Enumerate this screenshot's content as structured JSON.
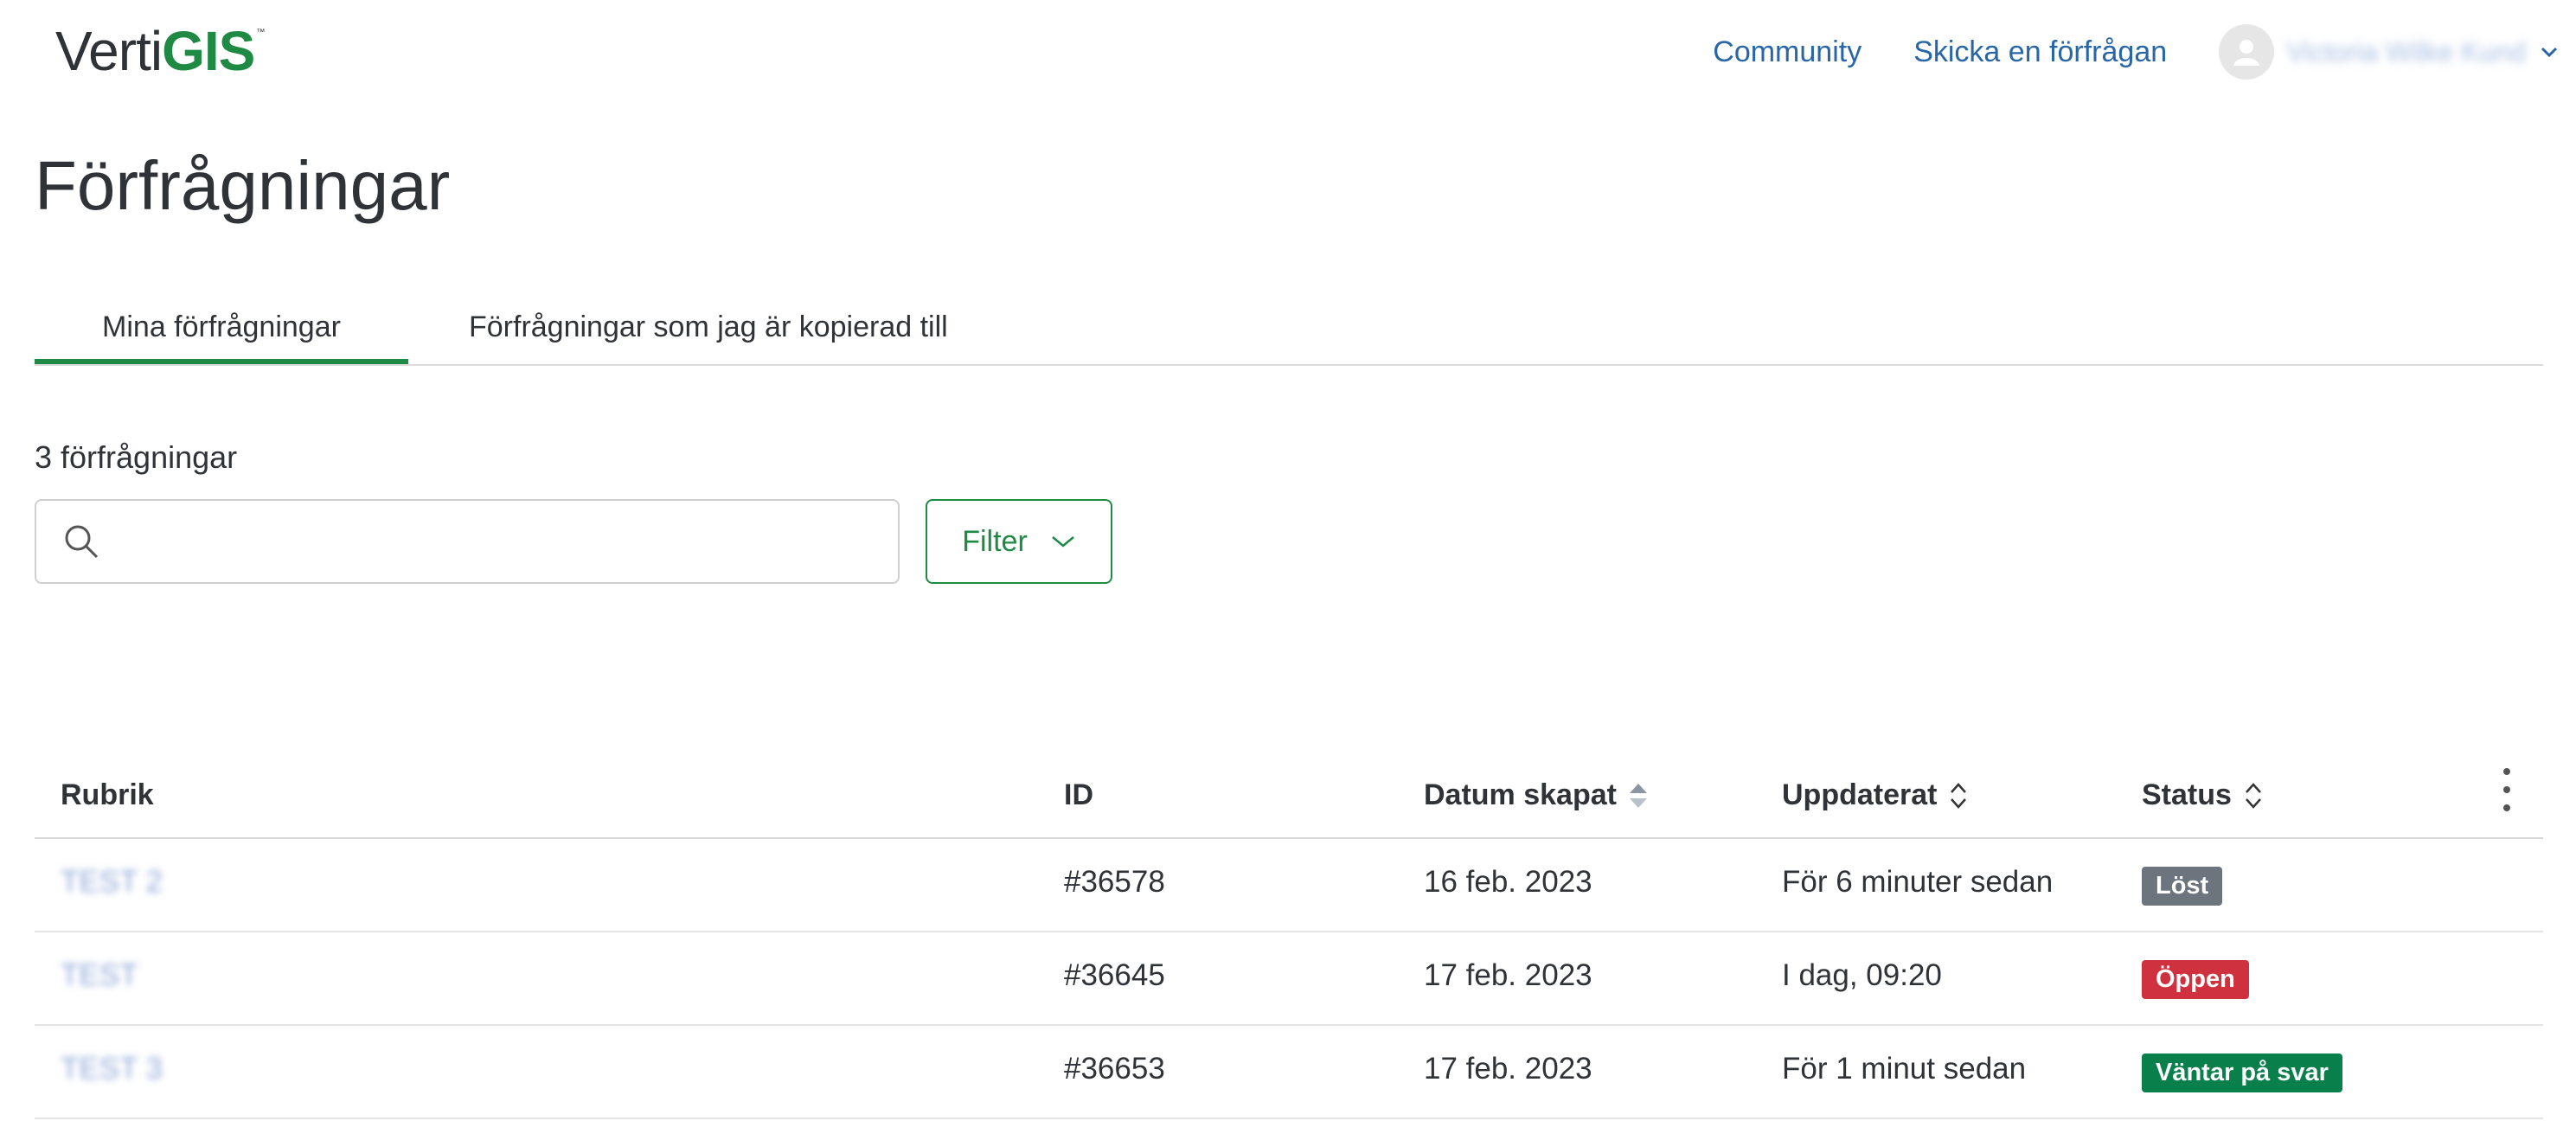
{
  "header": {
    "logo_part1": "Verti",
    "logo_part2": "GIS",
    "logo_tm": "™",
    "nav_community": "Community",
    "nav_submit_request": "Skicka en förfrågan",
    "user_name": "Victoria Wilke Kund"
  },
  "page": {
    "title": "Förfrågningar"
  },
  "tabs": [
    {
      "label": "Mina förfrågningar",
      "active": true
    },
    {
      "label": "Förfrågningar som jag är kopierad till",
      "active": false
    }
  ],
  "list": {
    "count_label": "3 förfrågningar",
    "search_placeholder": "",
    "filter_label": "Filter"
  },
  "table": {
    "columns": {
      "subject": "Rubrik",
      "id": "ID",
      "created": "Datum skapat",
      "updated": "Uppdaterat",
      "status": "Status"
    },
    "rows": [
      {
        "subject": "TEST 2",
        "id": "#36578",
        "created": "16 feb. 2023",
        "updated": "För 6 minuter sedan",
        "status": "Löst",
        "status_color": "#6c757d"
      },
      {
        "subject": "TEST",
        "id": "#36645",
        "created": "17 feb. 2023",
        "updated": "I dag, 09:20",
        "status": "Öppen",
        "status_color": "#d0313e"
      },
      {
        "subject": "TEST 3",
        "id": "#36653",
        "created": "17 feb. 2023",
        "updated": "För 1 minut sedan",
        "status": "Väntar på svar",
        "status_color": "#097f4b"
      }
    ]
  },
  "colors": {
    "brand_green": "#1f8a43",
    "link_blue": "#2866a8",
    "text_dark": "#2f3337"
  },
  "icons": [
    "search-icon",
    "chevron-down-icon",
    "sort-icon",
    "user-avatar-icon",
    "kebab-menu-icon"
  ]
}
